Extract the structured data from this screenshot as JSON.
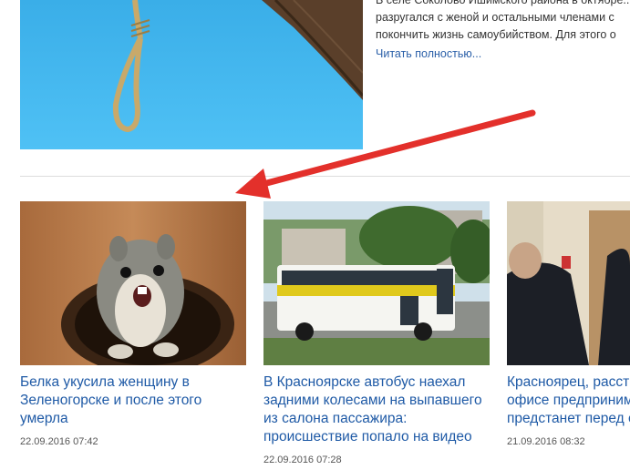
{
  "top_article": {
    "excerpt_lines": [
      "В селе Соколово Ишимского района в октябре...",
      "разругался с женой и остальными членами с",
      "покончить жизнь самоубийством. Для этого о"
    ],
    "read_more": "Читать полностью..."
  },
  "news": [
    {
      "title_lines": [
        "Белка укусила женщину в",
        "Зеленогорске и после этого",
        "умерла"
      ],
      "date": "22.09.2016 07:42",
      "image": "squirrel-photo"
    },
    {
      "title_lines": [
        "В Красноярске автобус наехал",
        "задними колесами на выпавшего",
        "из салона пассажира:",
        "происшествие попало на видео"
      ],
      "date": "22.09.2016 07:28",
      "image": "bus-photo"
    },
    {
      "title_lines": [
        "Красноярец, расстр",
        "офисе предприним",
        "предстанет перед с"
      ],
      "date": "21.09.2016 08:32",
      "image": "police-photo"
    }
  ],
  "annotation": {
    "color": "#e3302b"
  }
}
